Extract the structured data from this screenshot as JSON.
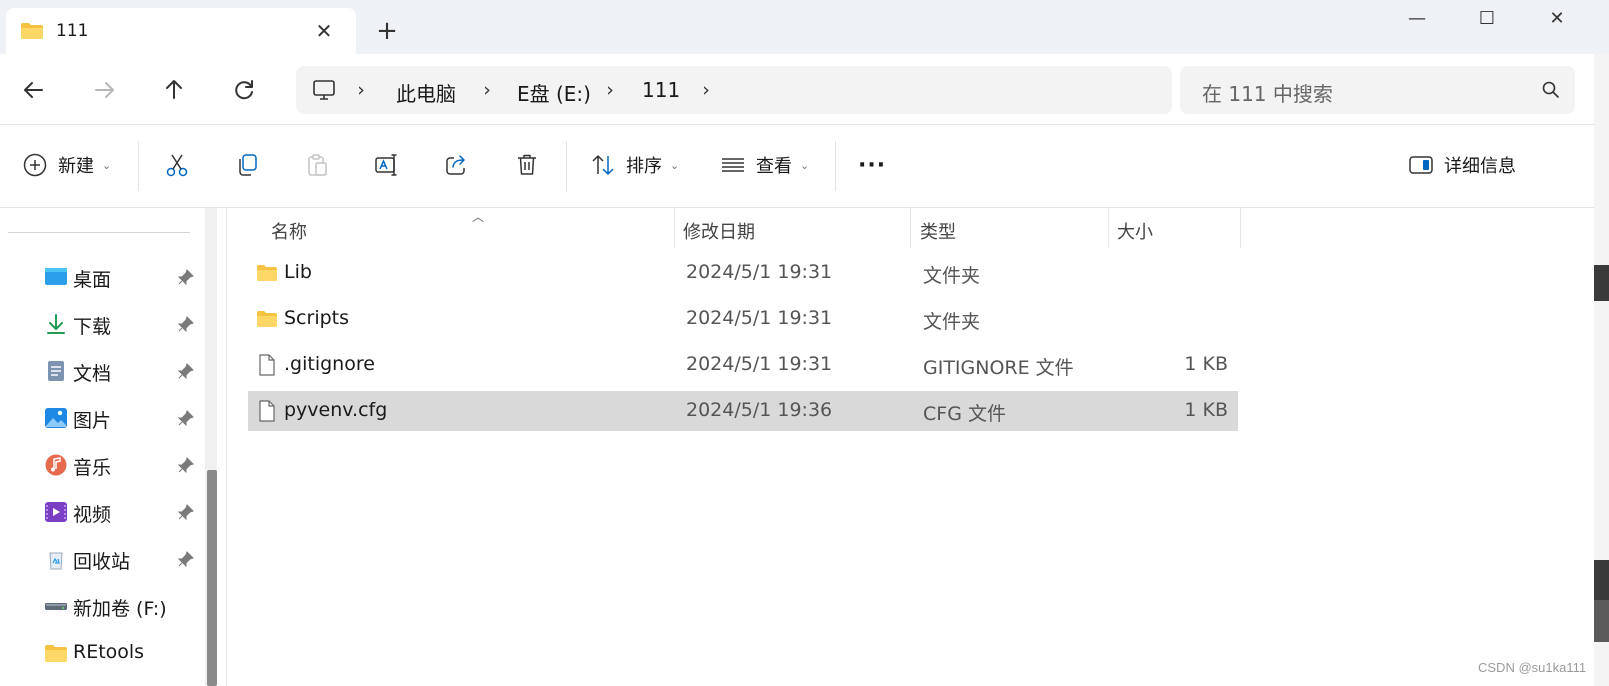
{
  "tab": {
    "title": "111",
    "close_glyph": "✕",
    "new_tab_glyph": "+"
  },
  "window_controls": {
    "minimize": "—",
    "maximize": "☐",
    "close": "✕"
  },
  "address": {
    "crumbs": [
      "此电脑",
      "E盘 (E:)",
      "111"
    ],
    "separator": "›"
  },
  "search": {
    "placeholder": "在 111 中搜索"
  },
  "commands": {
    "new_label": "新建",
    "sort_label": "排序",
    "view_label": "查看",
    "more_glyph": "···",
    "details_label": "详细信息",
    "caret": "⌄"
  },
  "sidebar": {
    "items": [
      {
        "label": "桌面",
        "icon": "desktop-icon",
        "pinned": true
      },
      {
        "label": "下载",
        "icon": "download-icon",
        "pinned": true
      },
      {
        "label": "文档",
        "icon": "documents-icon",
        "pinned": true
      },
      {
        "label": "图片",
        "icon": "pictures-icon",
        "pinned": true
      },
      {
        "label": "音乐",
        "icon": "music-icon",
        "pinned": true
      },
      {
        "label": "视频",
        "icon": "videos-icon",
        "pinned": true
      },
      {
        "label": "回收站",
        "icon": "recycle-bin-icon",
        "pinned": true
      },
      {
        "label": "新加卷 (F:)",
        "icon": "drive-icon",
        "pinned": false
      },
      {
        "label": "REtools",
        "icon": "folder-icon",
        "pinned": false
      }
    ]
  },
  "columns": {
    "name": "名称",
    "modified": "修改日期",
    "type": "类型",
    "size": "大小"
  },
  "files": [
    {
      "name": "Lib",
      "modified": "2024/5/1 19:31",
      "type": "文件夹",
      "size": "",
      "kind": "folder",
      "selected": false
    },
    {
      "name": "Scripts",
      "modified": "2024/5/1 19:31",
      "type": "文件夹",
      "size": "",
      "kind": "folder",
      "selected": false
    },
    {
      "name": ".gitignore",
      "modified": "2024/5/1 19:31",
      "type": "GITIGNORE 文件",
      "size": "1 KB",
      "kind": "file",
      "selected": false
    },
    {
      "name": "pyvenv.cfg",
      "modified": "2024/5/1 19:36",
      "type": "CFG 文件",
      "size": "1 KB",
      "kind": "file",
      "selected": true
    }
  ],
  "watermark": "CSDN @su1ka111",
  "colors": {
    "accent": "#0067c0",
    "folder": "#f5c242",
    "selected_row": "#d9d9d9"
  }
}
